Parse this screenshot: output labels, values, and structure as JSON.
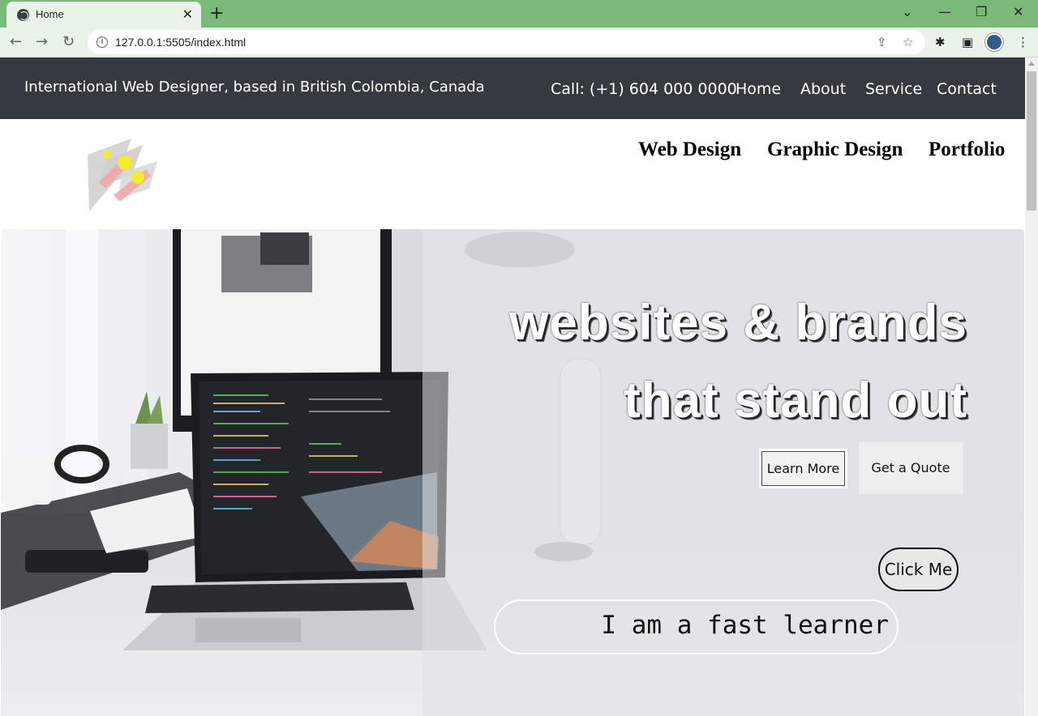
{
  "browser": {
    "tab_title": "Home",
    "tab_close": "✕",
    "new_tab": "+",
    "url": "127.0.0.1:5505/index.html",
    "info_icon": "i",
    "icons": [
      "back-arrow-icon",
      "forward-arrow-icon",
      "reload-icon",
      "share-icon",
      "star-icon",
      "extensions-icon",
      "side-panel-icon",
      "menu-icon"
    ],
    "window_controls": [
      "⌄",
      "—",
      "❐",
      "✕"
    ]
  },
  "topbar": {
    "tagline": "International Web Designer, based in British Colombia, Canada",
    "call": "Call: (+1) 604 000 0000",
    "menu": [
      "Home",
      "About",
      "Service",
      "Contact"
    ]
  },
  "services_nav": [
    "Web Design",
    "Graphic Design",
    "Portfolio"
  ],
  "hero": {
    "headline_line1": "websites & brands",
    "headline_line2": "that stand out",
    "learn_more": "Learn More",
    "get_quote": "Get a Quote",
    "click_me": "Click Me",
    "typing_text": "I am a fast learner"
  },
  "colors": {
    "tab_strip": "#7ab97a",
    "toolbar": "#eaf3e9",
    "topbar_bg": "#343a40",
    "hero_bg": "#e1e2e5"
  }
}
